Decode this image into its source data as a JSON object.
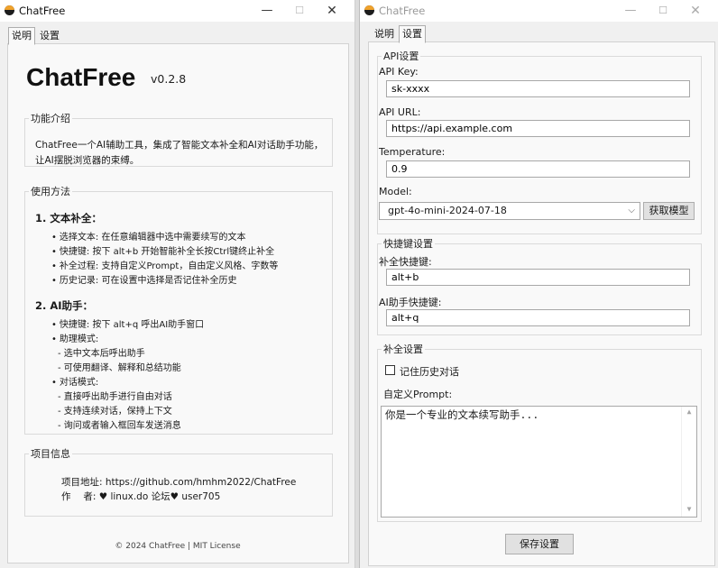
{
  "left_window": {
    "title": "ChatFree",
    "controls": {
      "minimize": "—",
      "maximize": "☐",
      "close": "✕"
    },
    "tabs": [
      {
        "label": "说明",
        "active": true
      },
      {
        "label": "设置",
        "active": false
      }
    ],
    "app_name": "ChatFree",
    "version": "v0.2.8",
    "intro": {
      "title": "功能介绍",
      "text": "ChatFree一个AI辅助工具，集成了智能文本补全和AI对话助手功能，让AI摆脱浏览器的束缚。"
    },
    "usage": {
      "title": "使用方法",
      "section1_title": "1. 文本补全：",
      "section1_items": [
        "选择文本: 在任意编辑器中选中需要续写的文本",
        "快捷键: 按下 alt+b 开始智能补全长按Ctrl键终止补全",
        "补全过程: 支持自定义Prompt，自由定义风格、字数等",
        "历史记录: 可在设置中选择是否记住补全历史"
      ],
      "section2_title": "2. AI助手：",
      "section2_hotkey": "快捷键: 按下 alt+q 呼出AI助手窗口",
      "assist_mode_title": "助理模式:",
      "assist_mode_items": [
        "- 选中文本后呼出助手",
        "- 可使用翻译、解释和总结功能"
      ],
      "chat_mode_title": "对话模式:",
      "chat_mode_items": [
        "- 直接呼出助手进行自由对话",
        "- 支持连续对话，保持上下文",
        "- 询问或者输入框回车发送消息"
      ]
    },
    "project": {
      "title": "项目信息",
      "repo": "项目地址: https://github.com/hmhm2022/ChatFree",
      "author": "作　 者: ♥ linux.do 论坛♥  user705"
    },
    "footer": "© 2024 ChatFree | MIT License"
  },
  "right_window": {
    "title": "ChatFree",
    "controls": {
      "minimize": "—",
      "maximize": "☐",
      "close": "✕"
    },
    "tabs": [
      {
        "label": "说明",
        "active": false
      },
      {
        "label": "设置",
        "active": true
      }
    ],
    "api": {
      "group_title": "API设置",
      "key_label": "API Key:",
      "key_value": "sk-xxxx",
      "url_label": "API URL:",
      "url_value": "https://api.example.com",
      "temp_label": "Temperature:",
      "temp_value": "0.9",
      "model_label": "Model:",
      "model_value": "gpt-4o-mini-2024-07-18",
      "fetch_button": "获取模型"
    },
    "hotkeys": {
      "group_title": "快捷键设置",
      "completion_label": "补全快捷键:",
      "completion_value": "alt+b",
      "assistant_label": "AI助手快捷键:",
      "assistant_value": "alt+q"
    },
    "completion": {
      "group_title": "补全设置",
      "remember_label": "记住历史对话",
      "remember_checked": false,
      "prompt_label": "自定义Prompt:",
      "prompt_value": "你是一个专业的文本续写助手..."
    },
    "save_button": "保存设置"
  }
}
